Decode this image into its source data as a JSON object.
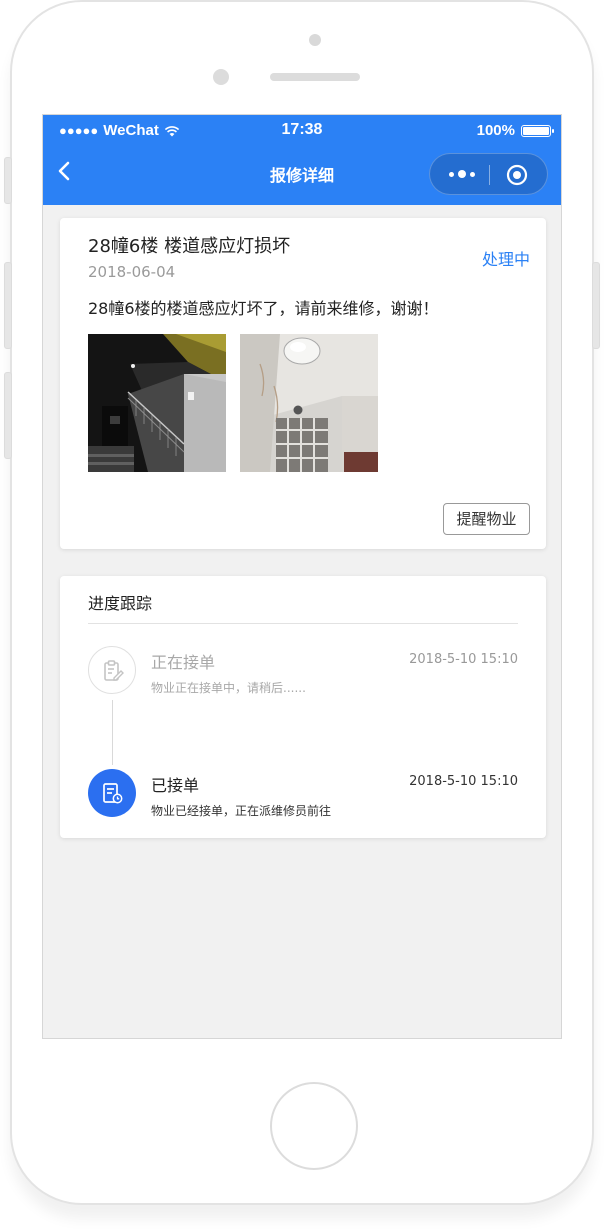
{
  "status_bar": {
    "signal_dots": "●●●●●",
    "carrier": "WeChat",
    "time": "17:38",
    "battery_text": "100%"
  },
  "nav": {
    "title": "报修详细"
  },
  "issue": {
    "title": "28幢6楼 楼道感应灯损坏",
    "date": "2018-06-04",
    "status": "处理中",
    "description": "28幢6楼的楼道感应灯坏了，请前来维修，谢谢！",
    "remind_button": "提醒物业"
  },
  "progress": {
    "title": "进度跟踪",
    "steps": [
      {
        "name": "正在接单",
        "time": "2018-5-10 15:10",
        "desc": "物业正在接单中，请稍后......",
        "state": "inactive",
        "icon": "clipboard-edit-icon"
      },
      {
        "name": "已接单",
        "time": "2018-5-10 15:10",
        "desc": "物业已经接单，正在派维修员前往",
        "state": "active",
        "icon": "order-accepted-icon"
      }
    ]
  },
  "colors": {
    "accent": "#2b81f5",
    "active_icon": "#2b6ff0",
    "background": "#f1f1f1"
  }
}
